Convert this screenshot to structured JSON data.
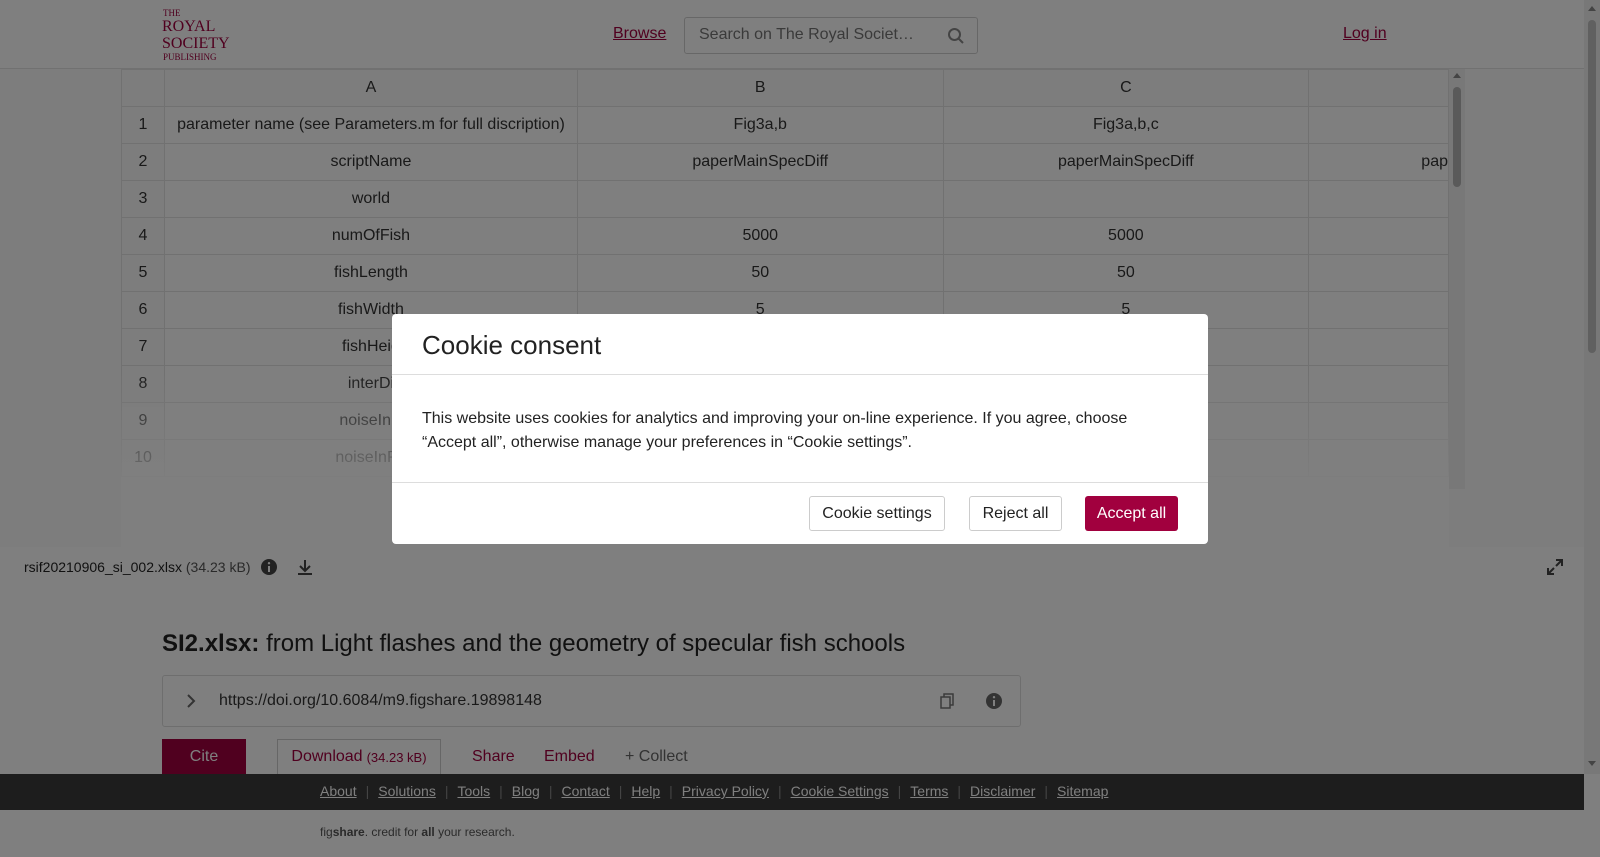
{
  "header": {
    "logo_text_1": "THE",
    "logo_text_2": "ROYAL",
    "logo_text_3": "SOCIETY",
    "logo_text_4": "PUBLISHING",
    "browse_label": "Browse",
    "search_placeholder": "Search on The Royal Societ…",
    "login_label": "Log in"
  },
  "spreadsheet": {
    "columns": [
      "",
      "A",
      "B",
      "C",
      ""
    ],
    "rows": [
      [
        "1",
        "parameter name (see Parameters.m for full discription)",
        "Fig3a,b",
        "Fig3a,b,c",
        ""
      ],
      [
        "2",
        "scriptName",
        "paperMainSpecDiff",
        "paperMainSpecDiff",
        "pap"
      ],
      [
        "3",
        "world",
        "",
        "",
        ""
      ],
      [
        "4",
        "numOfFish",
        "5000",
        "5000",
        ""
      ],
      [
        "5",
        "fishLength",
        "50",
        "50",
        ""
      ],
      [
        "6",
        "fishWidth",
        "5",
        "5",
        ""
      ],
      [
        "7",
        "fishHeig",
        "",
        "",
        ""
      ],
      [
        "8",
        "interDi",
        "",
        "",
        ""
      ],
      [
        "9",
        "noiseInR",
        "",
        "",
        ""
      ],
      [
        "10",
        "noiseInPh",
        "",
        "",
        ""
      ]
    ]
  },
  "filebar": {
    "filename": "rsif20210906_si_002.xlsx",
    "filesize": "(34.23 kB)"
  },
  "main": {
    "title_bold": "SI2.xlsx:",
    "title_rest": " from Light flashes and the geometry of specular fish schools",
    "doi": "https://doi.org/10.6084/m9.figshare.19898148",
    "cite_label": "Cite",
    "download_label": "Download",
    "download_size": "(34.23 kB)",
    "share_label": "Share",
    "embed_label": "Embed",
    "collect_label": "+ Collect"
  },
  "footer": {
    "links": [
      "About",
      "Solutions",
      "Tools",
      "Blog",
      "Contact",
      "Help",
      "Privacy Policy",
      "Cookie Settings",
      "Terms",
      "Disclaimer",
      "Sitemap"
    ],
    "tagline_1": "fig",
    "tagline_2": "share",
    "tagline_3": ". credit for ",
    "tagline_4": "all",
    "tagline_5": " your research."
  },
  "cookie_modal": {
    "title": "Cookie consent",
    "body": "This website uses cookies for analytics and improving your on-line experience. If you agree, choose “Accept all”, otherwise manage your preferences in “Cookie settings”.",
    "settings_label": "Cookie settings",
    "reject_label": "Reject all",
    "accept_label": "Accept all"
  },
  "colors": {
    "brand": "#a1003e",
    "footer_bg": "#3a3a3a"
  }
}
